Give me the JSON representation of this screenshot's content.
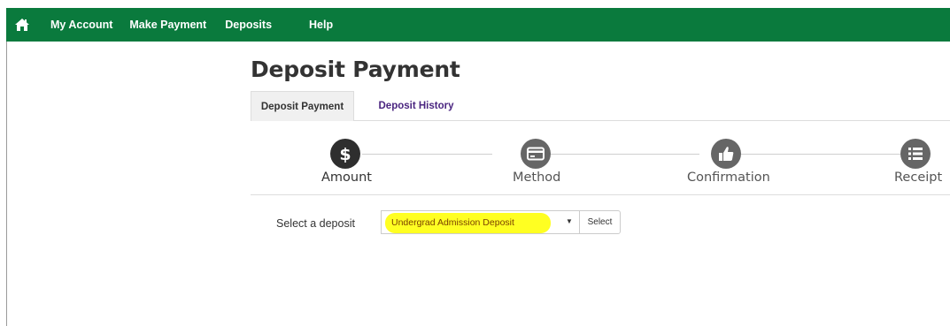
{
  "nav": {
    "items": [
      {
        "label": "My Account"
      },
      {
        "label": "Make Payment"
      },
      {
        "label": "Deposits"
      },
      {
        "label": "Help"
      }
    ]
  },
  "page": {
    "title": "Deposit Payment"
  },
  "tabs": [
    {
      "label": "Deposit Payment",
      "active": true
    },
    {
      "label": "Deposit History",
      "active": false
    }
  ],
  "steps": [
    {
      "label": "Amount",
      "icon": "dollar-icon",
      "state": "current"
    },
    {
      "label": "Method",
      "icon": "credit-card-icon",
      "state": "pending"
    },
    {
      "label": "Confirmation",
      "icon": "thumbs-up-icon",
      "state": "pending"
    },
    {
      "label": "Receipt",
      "icon": "list-icon",
      "state": "pending"
    }
  ],
  "deposit": {
    "label": "Select a deposit",
    "selected": "Undergrad Admission Deposit",
    "button_label": "Select"
  },
  "colors": {
    "nav_bg": "#0a7a3d",
    "link": "#4a2580",
    "highlight": "#ffff22"
  }
}
